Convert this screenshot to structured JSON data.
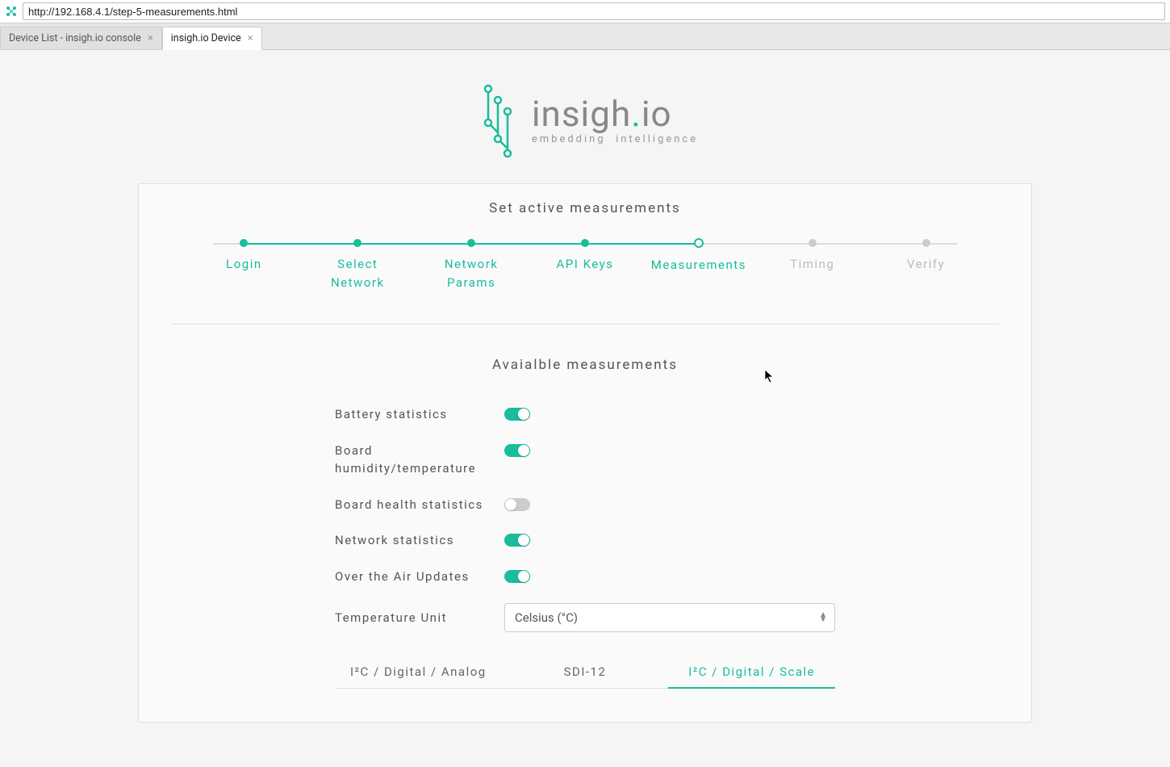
{
  "browser": {
    "url": "http://192.168.4.1/step-5-measurements.html",
    "tabs": [
      {
        "title": "Device List - insigh.io console",
        "active": false
      },
      {
        "title": "insigh.io Device",
        "active": true
      }
    ]
  },
  "brand": {
    "name": "insigh",
    "tld": "io",
    "tagline_a": "embedding",
    "tagline_b": "intelligence",
    "accent": "#1abc9c",
    "text_muted": "#888888"
  },
  "card": {
    "title": "Set active measurements"
  },
  "stepper": {
    "current_index": 4,
    "steps": [
      {
        "label": "Login"
      },
      {
        "label": "Select Network"
      },
      {
        "label": "Network Params"
      },
      {
        "label": "API Keys"
      },
      {
        "label": "Measurements"
      },
      {
        "label": "Timing"
      },
      {
        "label": "Verify"
      }
    ]
  },
  "section": {
    "title": "Avaialble measurements"
  },
  "measurements": [
    {
      "label": "Battery statistics",
      "on": true
    },
    {
      "label": "Board humidity/temperature",
      "on": true
    },
    {
      "label": "Board health statistics",
      "on": false
    },
    {
      "label": "Network statistics",
      "on": true
    },
    {
      "label": "Over the Air Updates",
      "on": true
    }
  ],
  "temperature": {
    "label": "Temperature Unit",
    "selected": "Celsius (°C)"
  },
  "subtabs": {
    "active_index": 2,
    "items": [
      {
        "label": "I²C / Digital / Analog"
      },
      {
        "label": "SDI-12"
      },
      {
        "label": "I²C / Digital / Scale"
      }
    ]
  }
}
